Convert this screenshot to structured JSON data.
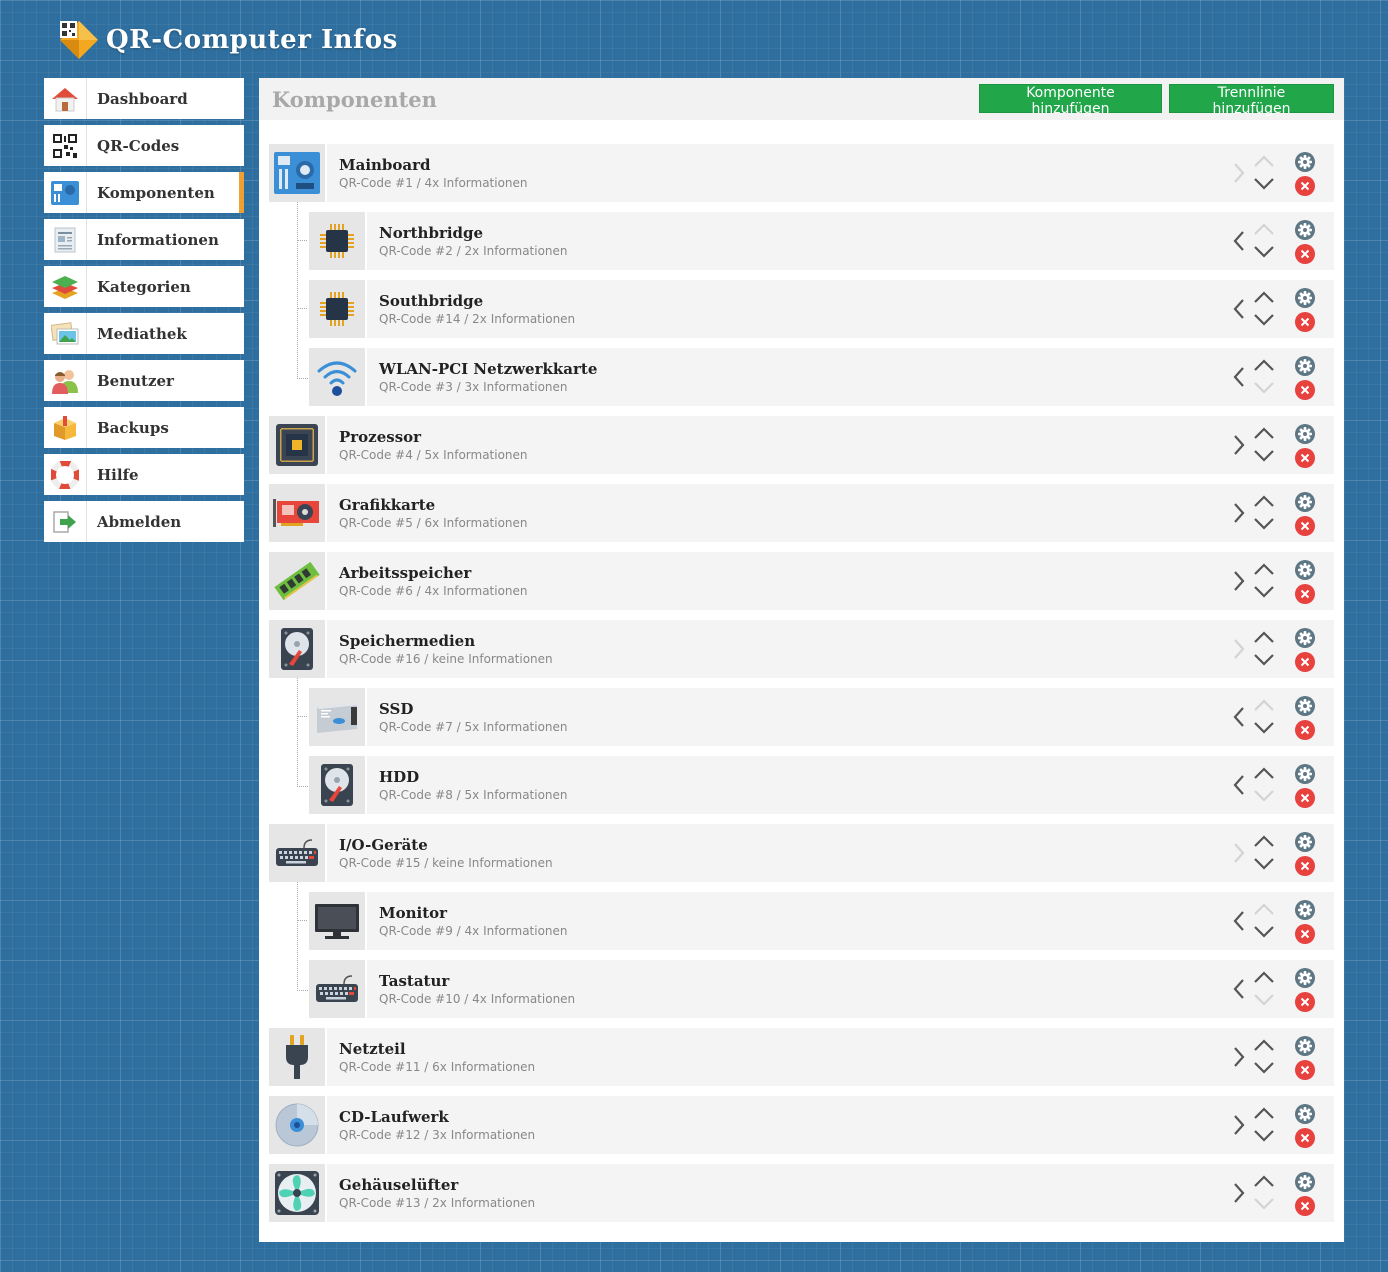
{
  "app": {
    "title": "QR-Computer Infos"
  },
  "sidebar": {
    "items": [
      {
        "label": "Dashboard",
        "icon": "house-icon"
      },
      {
        "label": "QR-Codes",
        "icon": "qr-code-icon"
      },
      {
        "label": "Komponenten",
        "icon": "motherboard-icon",
        "active": true
      },
      {
        "label": "Informationen",
        "icon": "document-icon"
      },
      {
        "label": "Kategorien",
        "icon": "layers-icon"
      },
      {
        "label": "Mediathek",
        "icon": "images-icon"
      },
      {
        "label": "Benutzer",
        "icon": "users-icon"
      },
      {
        "label": "Backups",
        "icon": "box-icon"
      },
      {
        "label": "Hilfe",
        "icon": "lifebuoy-icon"
      },
      {
        "label": "Abmelden",
        "icon": "logout-icon"
      }
    ]
  },
  "main": {
    "title": "Komponenten",
    "add_component_label": "Komponente hinzufügen",
    "add_separator_label": "Trennlinie hinzufügen",
    "components": [
      {
        "name": "Mainboard",
        "meta": "QR-Code #1 / 4x Informationen",
        "icon": "motherboard-icon",
        "level": 0
      },
      {
        "name": "Northbridge",
        "meta": "QR-Code #2 / 2x Informationen",
        "icon": "chip-icon",
        "level": 1
      },
      {
        "name": "Southbridge",
        "meta": "QR-Code #14 / 2x Informationen",
        "icon": "chip-icon",
        "level": 1
      },
      {
        "name": "WLAN-PCI Netzwerkkarte",
        "meta": "QR-Code #3 / 3x Informationen",
        "icon": "wifi-icon",
        "level": 1
      },
      {
        "name": "Prozessor",
        "meta": "QR-Code #4 / 5x Informationen",
        "icon": "cpu-icon",
        "level": 0
      },
      {
        "name": "Grafikkarte",
        "meta": "QR-Code #5 / 6x Informationen",
        "icon": "graphics-card-icon",
        "level": 0
      },
      {
        "name": "Arbeitsspeicher",
        "meta": "QR-Code #6 / 4x Informationen",
        "icon": "ram-icon",
        "level": 0
      },
      {
        "name": "Speichermedien",
        "meta": "QR-Code #16 / keine Informationen",
        "icon": "hard-disk-icon",
        "level": 0
      },
      {
        "name": "SSD",
        "meta": "QR-Code #7 / 5x Informationen",
        "icon": "ssd-icon",
        "level": 1
      },
      {
        "name": "HDD",
        "meta": "QR-Code #8 / 5x Informationen",
        "icon": "hard-disk-icon",
        "level": 1
      },
      {
        "name": "I/O-Geräte",
        "meta": "QR-Code #15 / keine Informationen",
        "icon": "keyboard-icon",
        "level": 0
      },
      {
        "name": "Monitor",
        "meta": "QR-Code #9 / 4x Informationen",
        "icon": "monitor-icon",
        "level": 1
      },
      {
        "name": "Tastatur",
        "meta": "QR-Code #10 / 4x Informationen",
        "icon": "keyboard-icon",
        "level": 1
      },
      {
        "name": "Netzteil",
        "meta": "QR-Code #11 / 6x Informationen",
        "icon": "power-plug-icon",
        "level": 0
      },
      {
        "name": "CD-Laufwerk",
        "meta": "QR-Code #12 / 3x Informationen",
        "icon": "cd-icon",
        "level": 0
      },
      {
        "name": "Gehäuselüfter",
        "meta": "QR-Code #13 / 2x Informationen",
        "icon": "fan-icon",
        "level": 0
      }
    ]
  },
  "colors": {
    "accent_green": "#21a64a",
    "delete_red": "#e8423f",
    "gear_gray": "#5e7785",
    "active_marker": "#f0a030",
    "background": "#2f6f9f"
  }
}
